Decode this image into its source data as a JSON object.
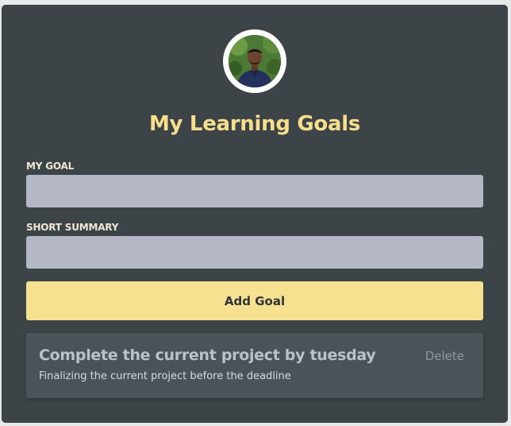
{
  "profile": {
    "avatar_icon": "user-avatar-photo"
  },
  "header": {
    "title": "My Learning Goals"
  },
  "form": {
    "goal_label": "MY GOAL",
    "goal_value": "",
    "summary_label": "SHORT SUMMARY",
    "summary_value": "",
    "add_button_label": "Add Goal"
  },
  "goals": [
    {
      "title": "Complete the current project by tuesday",
      "summary": "Finalizing the current project before the deadline",
      "delete_label": "Delete"
    }
  ],
  "colors": {
    "card_background": "#3c4448",
    "accent": "#f7de8c",
    "input_background": "#b4b7c5",
    "button_background": "#f5e18f",
    "goal_card_background": "#4b5358"
  }
}
